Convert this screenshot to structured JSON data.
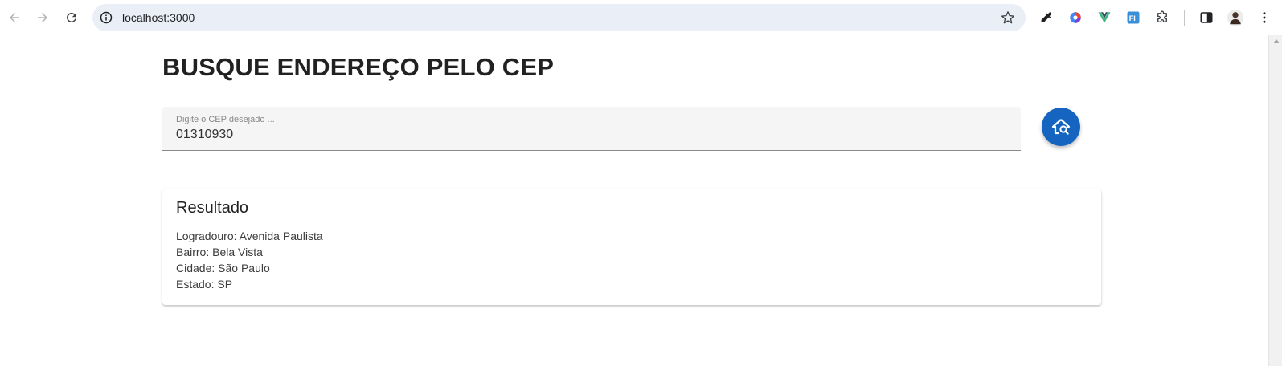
{
  "browser": {
    "url": "localhost:3000"
  },
  "page": {
    "title": "BUSQUE ENDEREÇO PELO CEP",
    "cep_label": "Digite o CEP desejado ...",
    "cep_value": "01310930"
  },
  "result": {
    "title": "Resultado",
    "lines": [
      "Logradouro: Avenida Paulista",
      "Bairro: Bela Vista",
      "Cidade: São Paulo",
      "Estado: SP"
    ]
  },
  "colors": {
    "primary": "#1565c0",
    "omnibox_bg": "#eaeef7",
    "field_bg": "#f5f5f5"
  },
  "icons": {
    "back": "arrow-left-icon",
    "forward": "arrow-right-icon",
    "reload": "reload-icon",
    "site_info": "info-icon",
    "bookmark": "star-icon",
    "search_button": "home-search-icon"
  }
}
